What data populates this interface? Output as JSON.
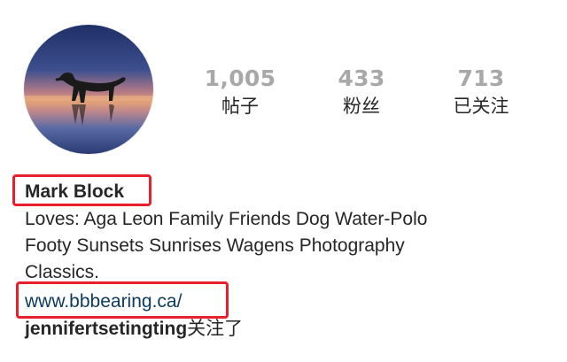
{
  "profile": {
    "avatar_icon": "dog-silhouette-sunset-avatar",
    "stats": [
      {
        "count": "1,005",
        "label": "帖子"
      },
      {
        "count": "433",
        "label": "粉丝"
      },
      {
        "count": "713",
        "label": "已关注"
      }
    ],
    "name": "Mark Block",
    "bio_lines": [
      "Loves: Aga Leon Family Friends Dog Water-Polo",
      "Footy Sunsets Sunrises Wagens Photography",
      "Classics."
    ],
    "website": "www.bbbearing.ca/",
    "followed_by": {
      "username": "jennifertsetingting",
      "suffix": "关注了"
    }
  },
  "colors": {
    "count_gray": "#a8a8a8",
    "text": "#262626",
    "link": "#0c3a5c",
    "highlight_red": "#e8202e"
  }
}
